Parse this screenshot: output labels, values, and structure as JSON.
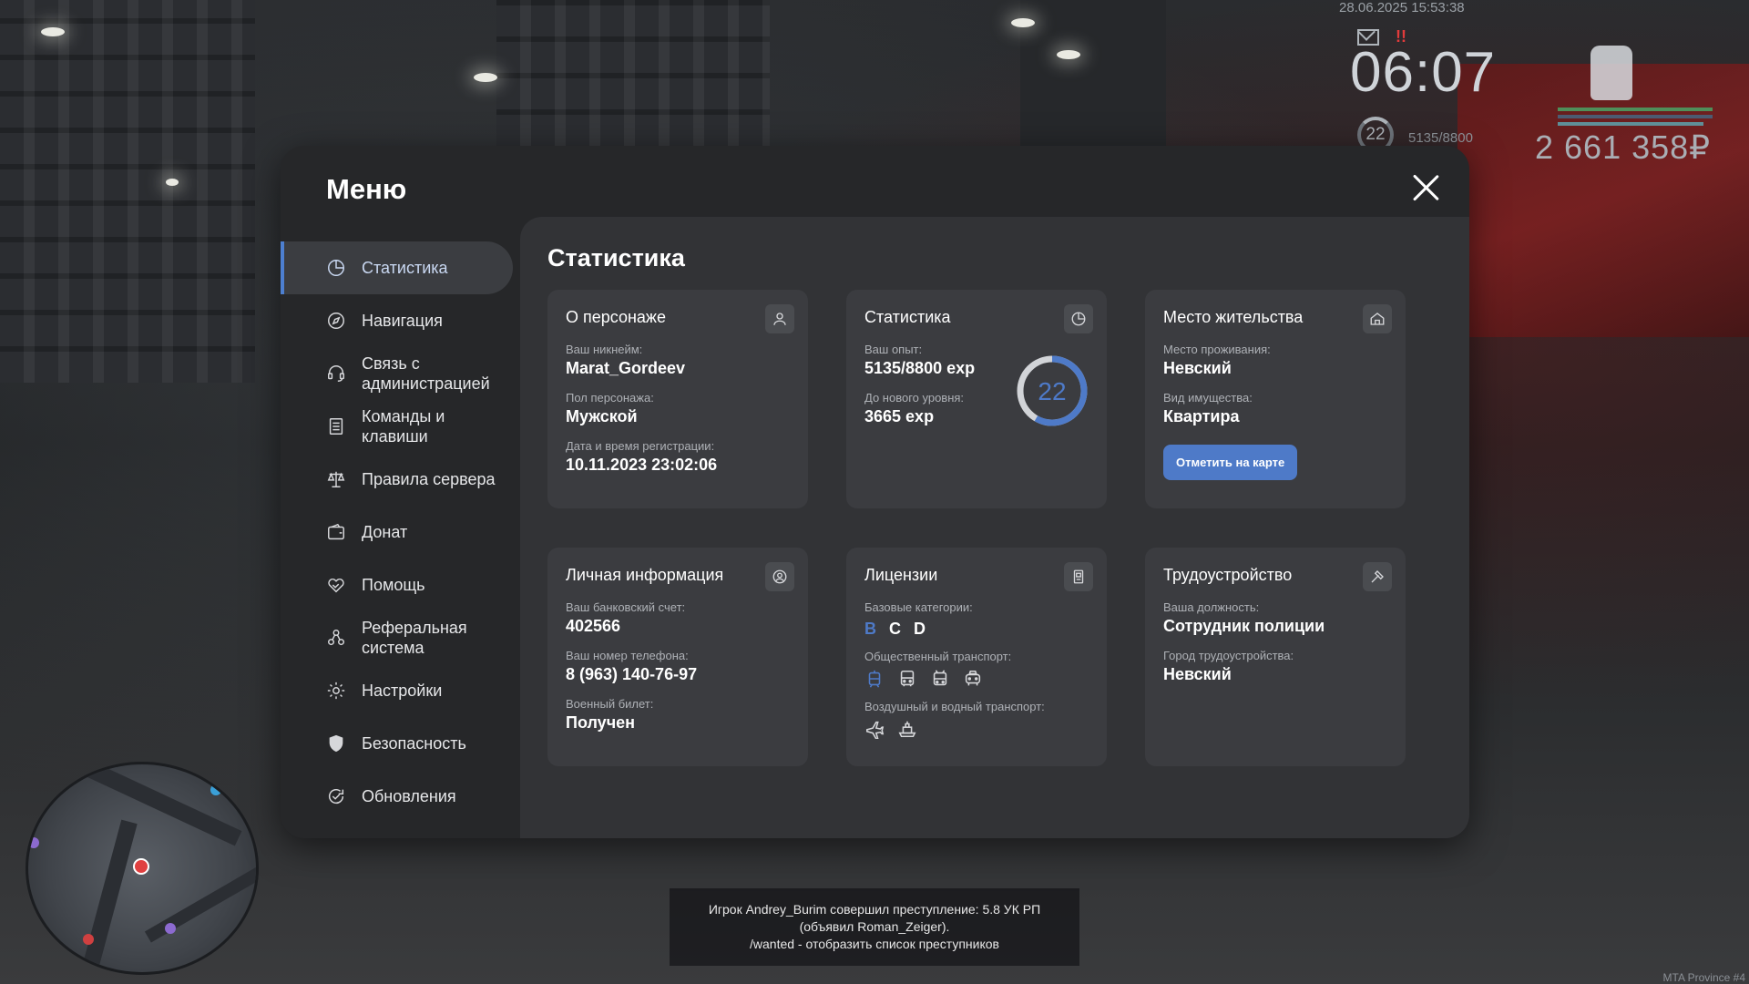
{
  "hud": {
    "datetime": "28.06.2025 15:53:38",
    "time": "06:07",
    "level": "22",
    "exp": "5135/8800",
    "money": "2 661 358₽",
    "alert": "!!"
  },
  "menu": {
    "title": "Меню",
    "sidebar": [
      {
        "label": "Статистика",
        "icon": "pie-chart-icon",
        "active": true
      },
      {
        "label": "Навигация",
        "icon": "compass-icon"
      },
      {
        "label": "Связь с администрацией",
        "icon": "headset-icon"
      },
      {
        "label": "Команды и клавиши",
        "icon": "document-icon"
      },
      {
        "label": "Правила сервера",
        "icon": "scales-icon"
      },
      {
        "label": "Донат",
        "icon": "wallet-icon"
      },
      {
        "label": "Помощь",
        "icon": "handshake-icon"
      },
      {
        "label": "Реферальная система",
        "icon": "referral-icon"
      },
      {
        "label": "Настройки",
        "icon": "gear-icon"
      },
      {
        "label": "Безопасность",
        "icon": "shield-icon"
      },
      {
        "label": "Обновления",
        "icon": "refresh-check-icon"
      }
    ],
    "content_title": "Статистика",
    "cards": {
      "character": {
        "title": "О персонаже",
        "nickname_label": "Ваш никнейм:",
        "nickname": "Marat_Gordeev",
        "gender_label": "Пол персонажа:",
        "gender": "Мужской",
        "reg_label": "Дата и время регистрации:",
        "reg": "10.11.2023 23:02:06"
      },
      "stats": {
        "title": "Статистика",
        "exp_label": "Ваш опыт:",
        "exp": "5135/8800 exp",
        "next_label": "До нового уровня:",
        "next": "3665 exp",
        "level": "22",
        "progress": 0.583
      },
      "residence": {
        "title": "Место жительства",
        "place_label": "Место проживания:",
        "place": "Невский",
        "property_label": "Вид имущества:",
        "property": "Квартира",
        "button": "Отметить на карте"
      },
      "personal": {
        "title": "Личная информация",
        "bank_label": "Ваш банковский счет:",
        "bank": "402566",
        "phone_label": "Ваш номер телефона:",
        "phone": "8 (963) 140-76-97",
        "military_label": "Военный билет:",
        "military": "Получен"
      },
      "licenses": {
        "title": "Лицензии",
        "base_label": "Базовые категории:",
        "categories": [
          "B",
          "C",
          "D"
        ],
        "public_label": "Общественный транспорт:",
        "air_label": "Воздушный и водный транспорт:"
      },
      "employment": {
        "title": "Трудоустройство",
        "position_label": "Ваша должность:",
        "position": "Сотрудник полиции",
        "city_label": "Город трудоустройства:",
        "city": "Невский"
      }
    }
  },
  "chat": {
    "line1": "Игрок Andrey_Burim совершил преступление: 5.8 УК РП",
    "line2": "(объявил Roman_Zeiger).",
    "line3": "/wanted - отобразить список преступников"
  },
  "server_tag": "MTA Province #4",
  "colors": {
    "accent": "#4e7ac8",
    "alert": "#e23b3b"
  }
}
